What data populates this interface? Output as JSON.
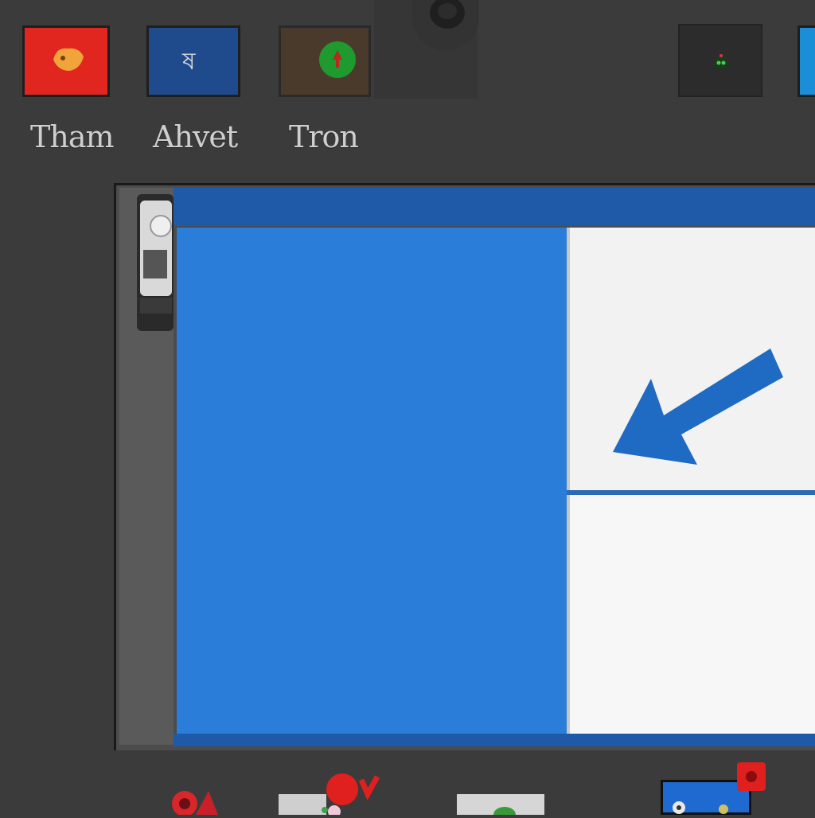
{
  "launcher": {
    "apps": [
      {
        "label": "Tham"
      },
      {
        "label": "Ahvet"
      },
      {
        "label": "Tron"
      }
    ]
  },
  "colors": {
    "background": "#3b3b3b",
    "window_accent": "#1f5aa8",
    "panel_blue": "#2a7dd8",
    "panel_white": "#f2f2f2"
  },
  "icons": {
    "tile_1": "fox-icon",
    "tile_2": "script-glyph-icon",
    "tile_3": "green-badge-icon",
    "tile_4": "small-robot-icon",
    "arrow": "arrow-pointer-icon"
  }
}
